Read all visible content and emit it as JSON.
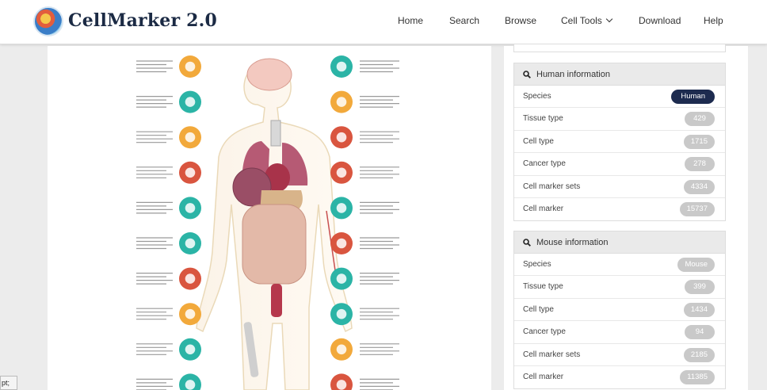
{
  "navbar": {
    "brand": "CellMarker 2.0",
    "items": [
      "Home",
      "Search",
      "Browse",
      "Cell Tools",
      "Download",
      "Help"
    ]
  },
  "human": {
    "title": "Human information",
    "rows": [
      {
        "label": "Species",
        "value": "Human"
      },
      {
        "label": "Tissue type",
        "value": "429"
      },
      {
        "label": "Cell type",
        "value": "1715"
      },
      {
        "label": "Cancer type",
        "value": "278"
      },
      {
        "label": "Cell marker sets",
        "value": "4334"
      },
      {
        "label": "Cell marker",
        "value": "15737"
      }
    ]
  },
  "mouse": {
    "title": "Mouse information",
    "rows": [
      {
        "label": "Species",
        "value": "Mouse"
      },
      {
        "label": "Tissue type",
        "value": "399"
      },
      {
        "label": "Cell type",
        "value": "1434"
      },
      {
        "label": "Cancer type",
        "value": "94"
      },
      {
        "label": "Cell marker sets",
        "value": "2185"
      },
      {
        "label": "Cell marker",
        "value": "11385"
      }
    ]
  },
  "corner_text": "pt;",
  "colors": {
    "accent_dark": "#1d2b4f",
    "badge_grey": "#c9c9c9",
    "icon_orange": "#f2a93b",
    "icon_teal": "#2bb4a6",
    "icon_red": "#d9553f"
  },
  "organ_icons_left": [
    "eye-icon",
    "ear-icon",
    "breast-icon",
    "stomach-icon",
    "cell-cluster-icon",
    "pancreas-icon",
    "kidney-icon",
    "placenta-icon",
    "uterus-icon",
    "intestine-icon"
  ],
  "organ_icons_right": [
    "brain-icon",
    "lung-icon",
    "heart-icon",
    "bladder-icon",
    "liver-icon",
    "vessel-icon",
    "colon-icon",
    "bone-icon",
    "spleen-icon",
    "tumor-icon"
  ]
}
